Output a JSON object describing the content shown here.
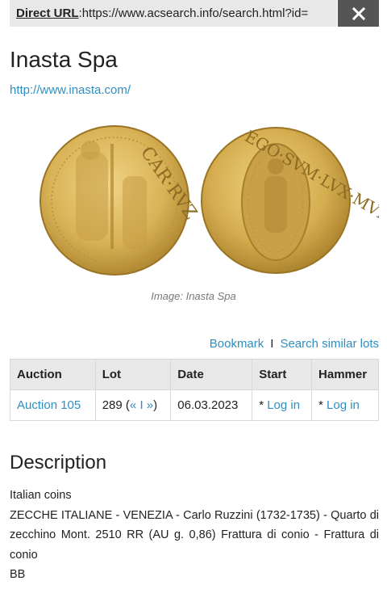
{
  "url_bar": {
    "label": "Direct URL",
    "separator": ": ",
    "url": "https://www.acsearch.info/search.html?id=",
    "close_icon": "close-icon"
  },
  "header": {
    "title": "Inasta Spa",
    "website": "http://www.inasta.com/"
  },
  "image": {
    "caption": "Image: Inasta Spa",
    "obverse_legend": "CAR·RVZ",
    "reverse_legend": "EGO·SVM·LVX·MVN"
  },
  "actions": {
    "bookmark": "Bookmark",
    "separator": "I",
    "search_similar": "Search similar lots"
  },
  "table": {
    "headers": [
      "Auction",
      "Lot",
      "Date",
      "Start",
      "Hammer"
    ],
    "row": {
      "auction": "Auction 105",
      "lot_number": "289",
      "lot_nav_open": "(",
      "lot_prev": "«",
      "lot_mid": "I",
      "lot_next": "»",
      "lot_nav_close": ")",
      "date": "06.03.2023",
      "start_prefix": "* ",
      "start_link": "Log in",
      "hammer_prefix": "* ",
      "hammer_link": "Log in"
    }
  },
  "description": {
    "heading": "Description",
    "line1": "Italian coins",
    "line2": "ZECCHE ITALIANE - VENEZIA - Carlo Ruzzini (1732-1735) - Quarto di zecchino Mont. 2510 RR (AU g. 0,86) Frattura di conio - Frattura di conio",
    "line3": "BB"
  },
  "colors": {
    "link": "#2f8fc1",
    "gold": "#d9b256",
    "close_bg": "#555555"
  }
}
